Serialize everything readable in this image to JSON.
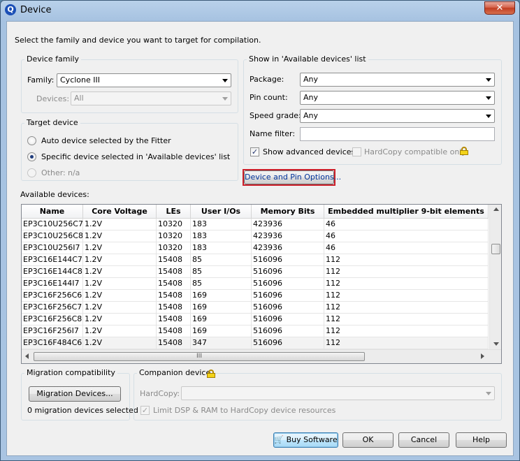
{
  "window": {
    "title": "Device",
    "close_glyph": "✕"
  },
  "instruction": "Select the family and device you want to target for compilation.",
  "device_family": {
    "legend": "Device family",
    "family_label": "Family:",
    "family_value": "Cyclone III",
    "devices_label": "Devices:",
    "devices_value": "All"
  },
  "target_device": {
    "legend": "Target device",
    "options": [
      {
        "label": "Auto device selected by the Fitter",
        "selected": false,
        "enabled": true
      },
      {
        "label": "Specific device selected in 'Available devices' list",
        "selected": true,
        "enabled": true
      },
      {
        "label": "Other:",
        "selected": false,
        "enabled": false
      }
    ],
    "other_value": "n/a"
  },
  "show_list": {
    "legend": "Show in 'Available devices' list",
    "package_label": "Package:",
    "package_value": "Any",
    "pin_count_label": "Pin count:",
    "pin_count_value": "Any",
    "speed_grade_label": "Speed grade:",
    "speed_grade_value": "Any",
    "name_filter_label": "Name filter:",
    "name_filter_value": "",
    "show_advanced_label": "Show advanced devices",
    "show_advanced_checked": true,
    "hardcopy_label": "HardCopy compatible only",
    "hardcopy_checked": false
  },
  "device_pin_options_label": "Device and Pin Options...",
  "available_devices": {
    "label": "Available devices:",
    "columns": [
      "Name",
      "Core Voltage",
      "LEs",
      "User I/Os",
      "Memory Bits",
      "Embedded multiplier 9-bit elements"
    ],
    "rows": [
      [
        "EP3C10U256C7",
        "1.2V",
        "10320",
        "183",
        "423936",
        "46"
      ],
      [
        "EP3C10U256C8",
        "1.2V",
        "10320",
        "183",
        "423936",
        "46"
      ],
      [
        "EP3C10U256I7",
        "1.2V",
        "10320",
        "183",
        "423936",
        "46"
      ],
      [
        "EP3C16E144C7",
        "1.2V",
        "15408",
        "85",
        "516096",
        "112"
      ],
      [
        "EP3C16E144C8",
        "1.2V",
        "15408",
        "85",
        "516096",
        "112"
      ],
      [
        "EP3C16E144I7",
        "1.2V",
        "15408",
        "85",
        "516096",
        "112"
      ],
      [
        "EP3C16F256C6",
        "1.2V",
        "15408",
        "169",
        "516096",
        "112"
      ],
      [
        "EP3C16F256C7",
        "1.2V",
        "15408",
        "169",
        "516096",
        "112"
      ],
      [
        "EP3C16F256C8",
        "1.2V",
        "15408",
        "169",
        "516096",
        "112"
      ],
      [
        "EP3C16F256I7",
        "1.2V",
        "15408",
        "169",
        "516096",
        "112"
      ],
      [
        "EP3C16F484C6",
        "1.2V",
        "15408",
        "347",
        "516096",
        "112"
      ]
    ],
    "hscroll_grip": "III"
  },
  "migration": {
    "legend": "Migration compatibility",
    "button_label": "Migration Devices...",
    "status": "0 migration devices selected"
  },
  "companion": {
    "legend": "Companion device",
    "hardcopy_label": "HardCopy:",
    "hardcopy_value": "",
    "limit_label": "Limit DSP & RAM to HardCopy device resources",
    "limit_checked": true
  },
  "buttons": {
    "buy": "Buy Software",
    "ok": "OK",
    "cancel": "Cancel",
    "help": "Help"
  },
  "icons": {
    "app": "quartus-app-icon",
    "lock": "lock-icon",
    "cart": "shopping-cart-icon"
  }
}
